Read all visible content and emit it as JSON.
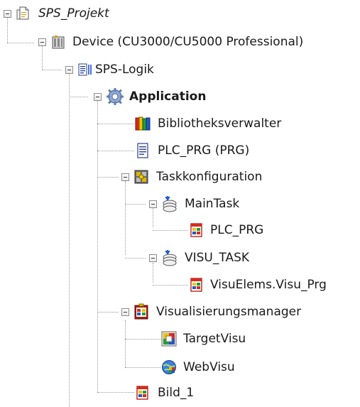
{
  "tree": {
    "root": {
      "label": "SPS_Projekt",
      "icon": "project-file-icon"
    },
    "device": {
      "label": "Device (CU3000/CU5000 Professional)",
      "icon": "device-icon"
    },
    "sps_logik": {
      "label": "SPS-Logik",
      "icon": "plc-logic-icon"
    },
    "application": {
      "label": "Application",
      "icon": "gear-icon"
    },
    "bibliotheksverwalter": {
      "label": "Bibliotheksverwalter",
      "icon": "library-books-icon"
    },
    "plc_prg": {
      "label": "PLC_PRG (PRG)",
      "icon": "program-document-icon"
    },
    "taskkonfiguration": {
      "label": "Taskkonfiguration",
      "icon": "task-configuration-icon"
    },
    "maintask": {
      "label": "MainTask",
      "icon": "task-icon"
    },
    "maintask_plc_prg": {
      "label": "PLC_PRG",
      "icon": "program-call-icon"
    },
    "visu_task": {
      "label": "VISU_TASK",
      "icon": "task-icon"
    },
    "visu_task_prg": {
      "label": "VisuElems.Visu_Prg",
      "icon": "program-call-icon"
    },
    "visualisierungsmanager": {
      "label": "Visualisierungsmanager",
      "icon": "visualization-manager-icon"
    },
    "targetvisu": {
      "label": "TargetVisu",
      "icon": "target-visu-icon"
    },
    "webvisu": {
      "label": "WebVisu",
      "icon": "web-visu-icon"
    },
    "bild_1": {
      "label": "Bild_1",
      "icon": "visualization-screen-icon"
    }
  }
}
